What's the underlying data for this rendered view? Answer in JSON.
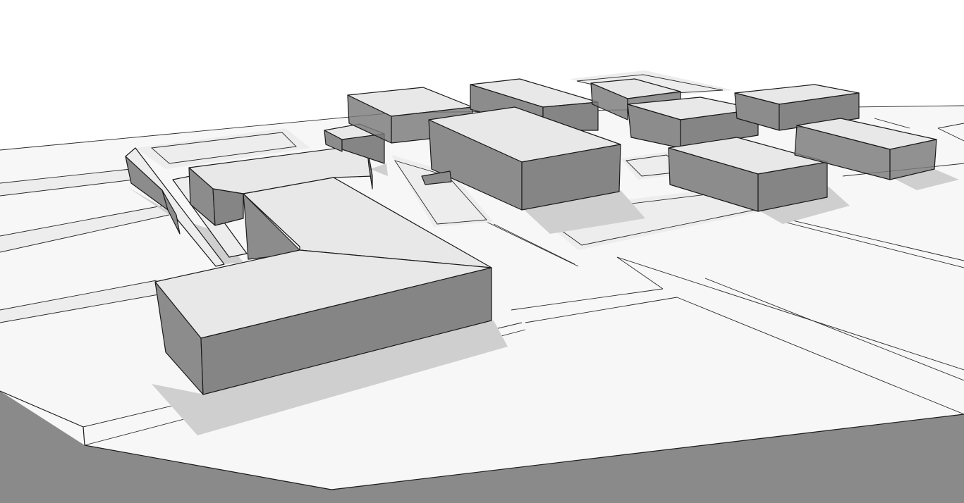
{
  "colors": {
    "sky": "#ffffff",
    "ground": "#f7f7f7",
    "shadow": "#cfcfcf",
    "roof": "#e8e8e8",
    "wall": "#8a8a8a",
    "edge": "#1a1a1a"
  }
}
